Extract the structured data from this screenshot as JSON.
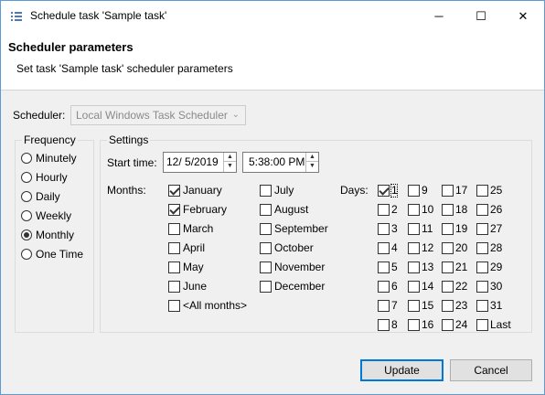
{
  "window": {
    "title": "Schedule task 'Sample task'",
    "minimize": "─",
    "maximize": "☐",
    "close": "✕"
  },
  "header": {
    "title": "Scheduler parameters",
    "subtitle": "Set task 'Sample task' scheduler parameters"
  },
  "scheduler": {
    "label": "Scheduler:",
    "value": "Local Windows Task Scheduler"
  },
  "frequency": {
    "title": "Frequency",
    "options": [
      {
        "label": "Minutely",
        "checked": false
      },
      {
        "label": "Hourly",
        "checked": false
      },
      {
        "label": "Daily",
        "checked": false
      },
      {
        "label": "Weekly",
        "checked": false
      },
      {
        "label": "Monthly",
        "checked": true
      },
      {
        "label": "One Time",
        "checked": false
      }
    ]
  },
  "settings": {
    "title": "Settings",
    "start_time_label": "Start time:",
    "date_value": "12/  5/2019",
    "time_value": "5:38:00 PM",
    "months_label": "Months:",
    "months_col1": [
      {
        "label": "January",
        "checked": true
      },
      {
        "label": "February",
        "checked": true
      },
      {
        "label": "March",
        "checked": false
      },
      {
        "label": "April",
        "checked": false
      },
      {
        "label": "May",
        "checked": false
      },
      {
        "label": "June",
        "checked": false
      },
      {
        "label": "<All months>",
        "checked": false
      }
    ],
    "months_col2": [
      {
        "label": "July",
        "checked": false
      },
      {
        "label": "August",
        "checked": false
      },
      {
        "label": "September",
        "checked": false
      },
      {
        "label": "October",
        "checked": false
      },
      {
        "label": "November",
        "checked": false
      },
      {
        "label": "December",
        "checked": false
      }
    ],
    "days_label": "Days:",
    "days": [
      [
        {
          "label": "1",
          "checked": true
        },
        {
          "label": "2",
          "checked": false
        },
        {
          "label": "3",
          "checked": false
        },
        {
          "label": "4",
          "checked": false
        },
        {
          "label": "5",
          "checked": false
        },
        {
          "label": "6",
          "checked": false
        },
        {
          "label": "7",
          "checked": false
        },
        {
          "label": "8",
          "checked": false
        }
      ],
      [
        {
          "label": "9",
          "checked": false
        },
        {
          "label": "10",
          "checked": false
        },
        {
          "label": "11",
          "checked": false
        },
        {
          "label": "12",
          "checked": false
        },
        {
          "label": "13",
          "checked": false
        },
        {
          "label": "14",
          "checked": false
        },
        {
          "label": "15",
          "checked": false
        },
        {
          "label": "16",
          "checked": false
        }
      ],
      [
        {
          "label": "17",
          "checked": false
        },
        {
          "label": "18",
          "checked": false
        },
        {
          "label": "19",
          "checked": false
        },
        {
          "label": "20",
          "checked": false
        },
        {
          "label": "21",
          "checked": false
        },
        {
          "label": "22",
          "checked": false
        },
        {
          "label": "23",
          "checked": false
        },
        {
          "label": "24",
          "checked": false
        }
      ],
      [
        {
          "label": "25",
          "checked": false
        },
        {
          "label": "26",
          "checked": false
        },
        {
          "label": "27",
          "checked": false
        },
        {
          "label": "28",
          "checked": false
        },
        {
          "label": "29",
          "checked": false
        },
        {
          "label": "30",
          "checked": false
        },
        {
          "label": "31",
          "checked": false
        },
        {
          "label": "Last",
          "checked": false
        }
      ]
    ]
  },
  "buttons": {
    "update": "Update",
    "cancel": "Cancel"
  }
}
